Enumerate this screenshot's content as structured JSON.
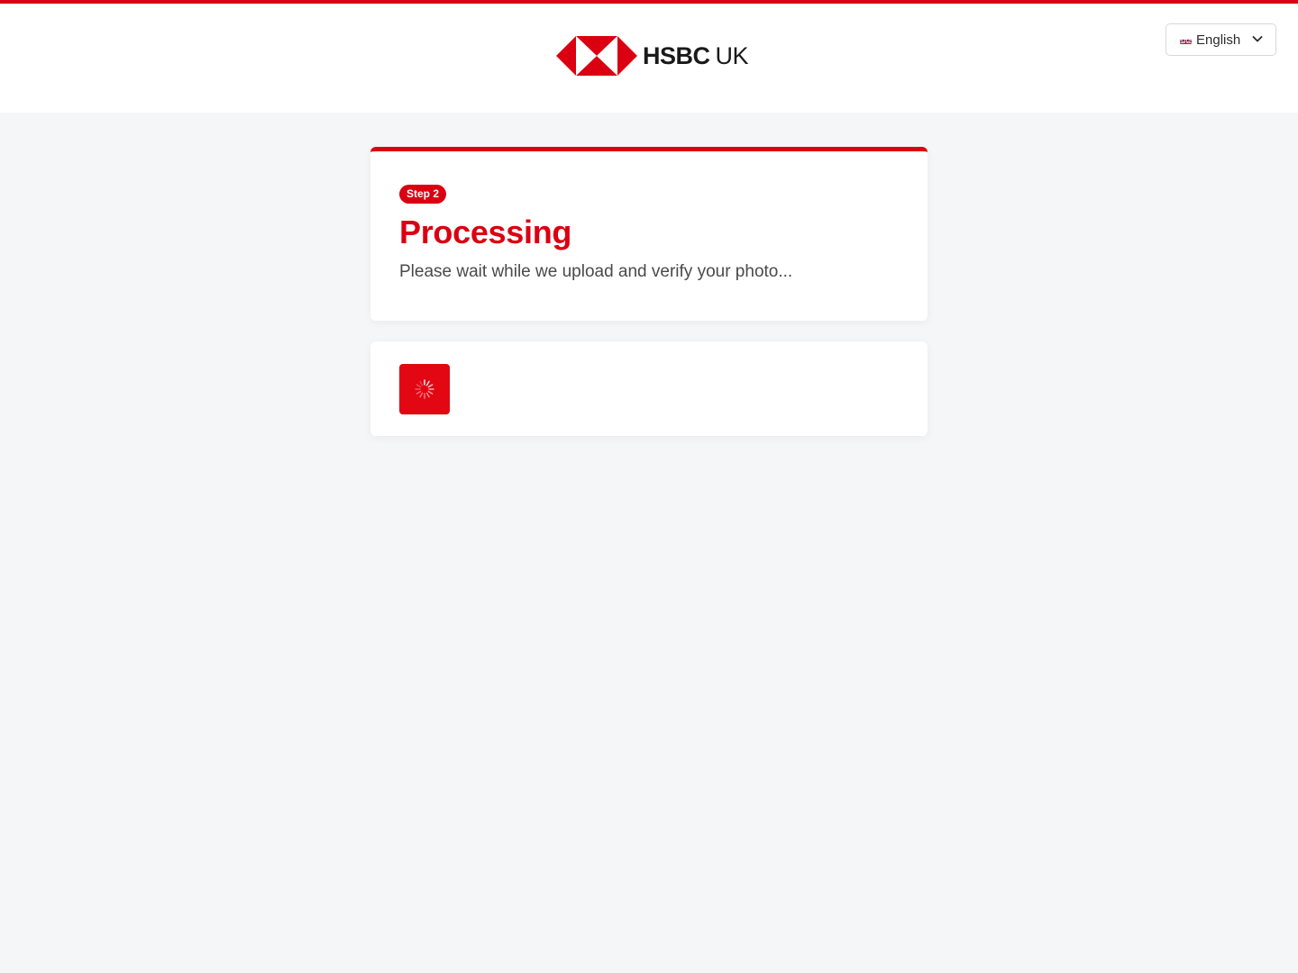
{
  "header": {
    "logo": {
      "brand": "HSBC",
      "region": "UK"
    },
    "language": {
      "selected": "English",
      "flag_icon": "uk-flag-icon"
    }
  },
  "step_card": {
    "badge": "Step 2",
    "title": "Processing",
    "subtitle": "Please wait while we upload and verify your photo..."
  },
  "status_card": {
    "icon": "spinner-icon"
  },
  "colors": {
    "accent": "#db0011",
    "spinner_bg": "#e30613",
    "page_bg": "#f5f6f8"
  }
}
